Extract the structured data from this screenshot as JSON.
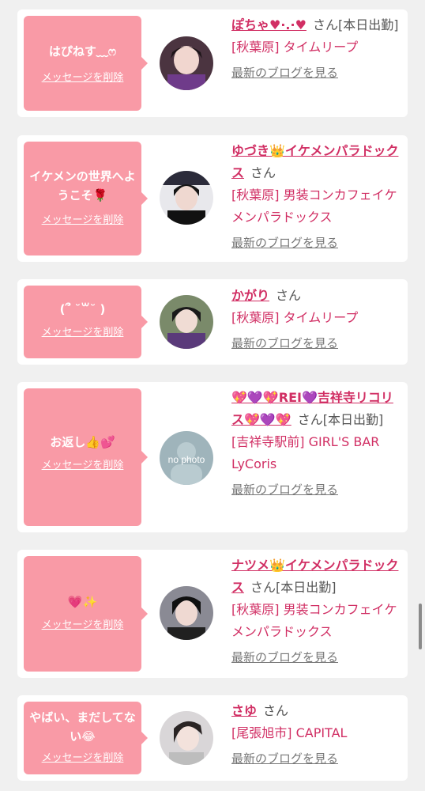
{
  "delete_label": "メッセージを削除",
  "blog_label": "最新のブログを見る",
  "san_label": "さん",
  "entries": [
    {
      "message": "はぴねす﹏ෆ",
      "name": "ぽちゃ♥·.·♥",
      "suffix": "[本日出勤]",
      "shop": "[秋葉原] タイムリープ",
      "avatar_color": "#4b3440"
    },
    {
      "message": "イケメンの世界へようこそ🌹",
      "name": "ゆづき👑イケメンパラドックス",
      "suffix": "",
      "shop": "[秋葉原] 男装コンカフェイケメンパラドックス",
      "avatar_color": "#2b2b3a"
    },
    {
      "message": "(՞ ˘꒳˘ )",
      "name": "かがり",
      "suffix": "",
      "shop": "[秋葉原] タイムリープ",
      "avatar_color": "#5a4a6a"
    },
    {
      "message": "お返し👍💕",
      "name": "💖💜💖REI💜吉祥寺リコリス💖💜💖",
      "suffix": "[本日出勤]",
      "shop": "[吉祥寺駅前] GIRL'S BAR LyCoris",
      "avatar_color": "#9fb4bb",
      "avatar_text": "no photo"
    },
    {
      "message": "💗✨",
      "name": "ナツメ👑イケメンパラドックス",
      "suffix": "[本日出勤]",
      "shop": "[秋葉原] 男装コンカフェイケメンパラドックス",
      "avatar_color": "#3a3a44"
    },
    {
      "message": "やばい、まだしてない😂",
      "name": "さゆ",
      "suffix": "",
      "shop": "[尾張旭市] CAPITAL",
      "avatar_color": "#d9d6d8"
    }
  ]
}
